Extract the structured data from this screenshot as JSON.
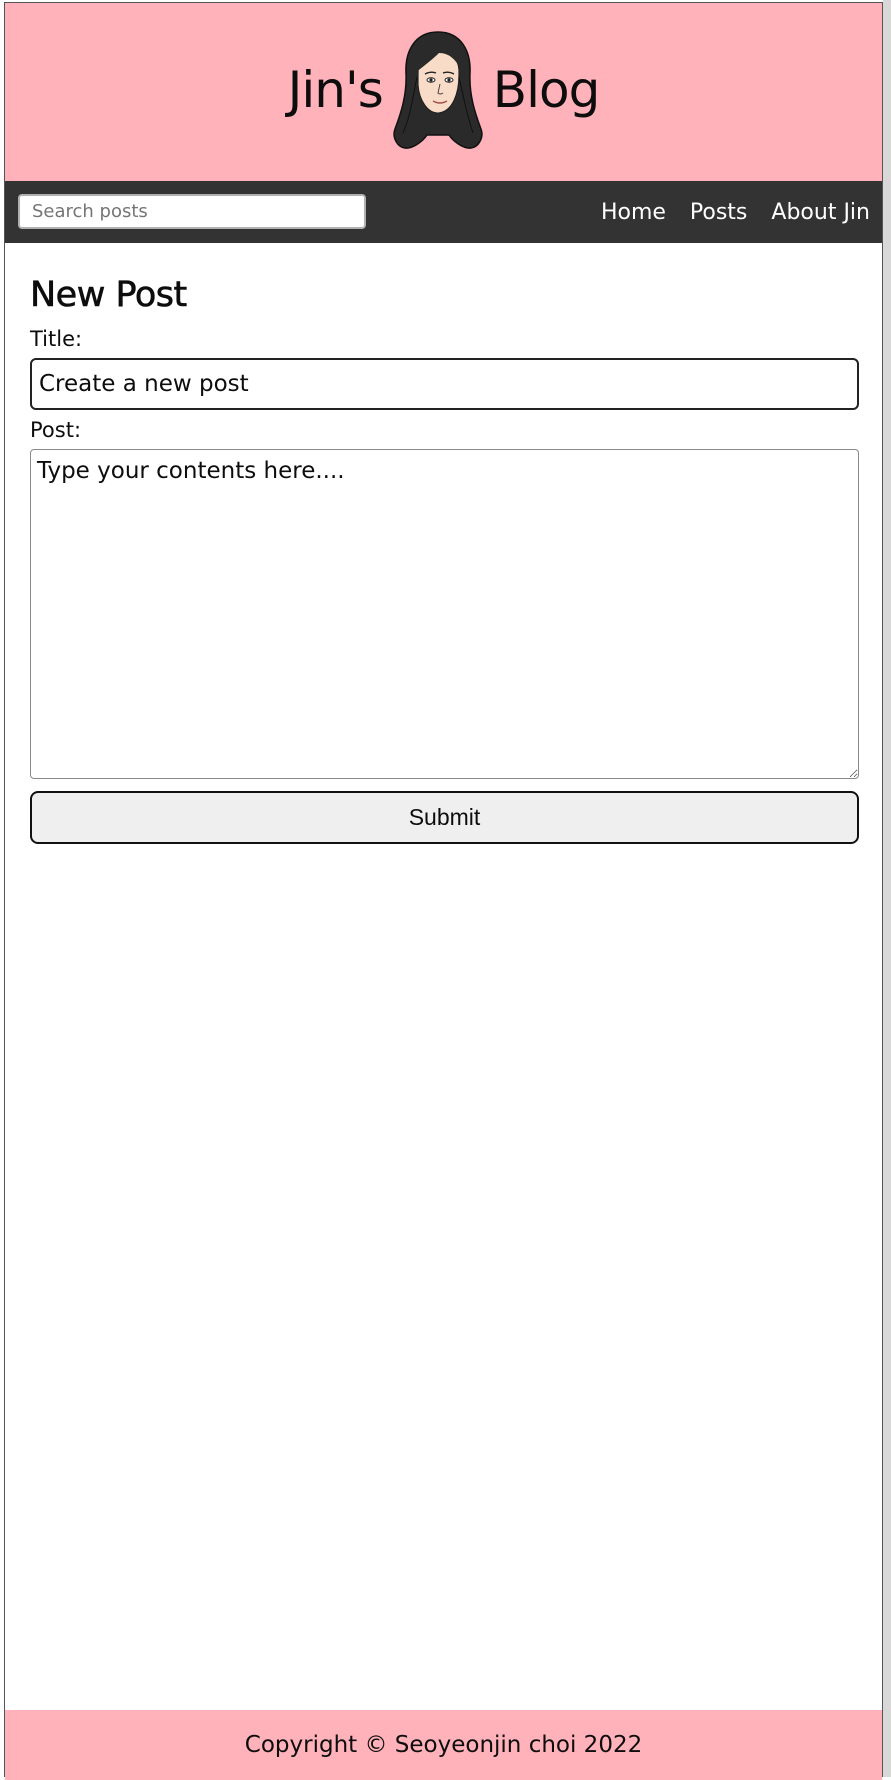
{
  "brand": {
    "left_text": "Jin's",
    "right_text": "Blog",
    "avatar_icon": "woman-avatar-icon"
  },
  "nav": {
    "search_placeholder": "Search posts",
    "links": [
      {
        "label": "Home"
      },
      {
        "label": "Posts"
      },
      {
        "label": "About Jin"
      }
    ]
  },
  "form": {
    "heading": "New Post",
    "title_label": "Title:",
    "title_value": "Create a new post",
    "post_label": "Post:",
    "post_value": "Type your contents here....",
    "submit_label": "Submit"
  },
  "footer": {
    "copyright": "Copyright © Seoyeonjin choi 2022"
  },
  "colors": {
    "header_bg": "#ffb2ba",
    "nav_bg": "#333333",
    "footer_bg": "#ffb2ba"
  }
}
